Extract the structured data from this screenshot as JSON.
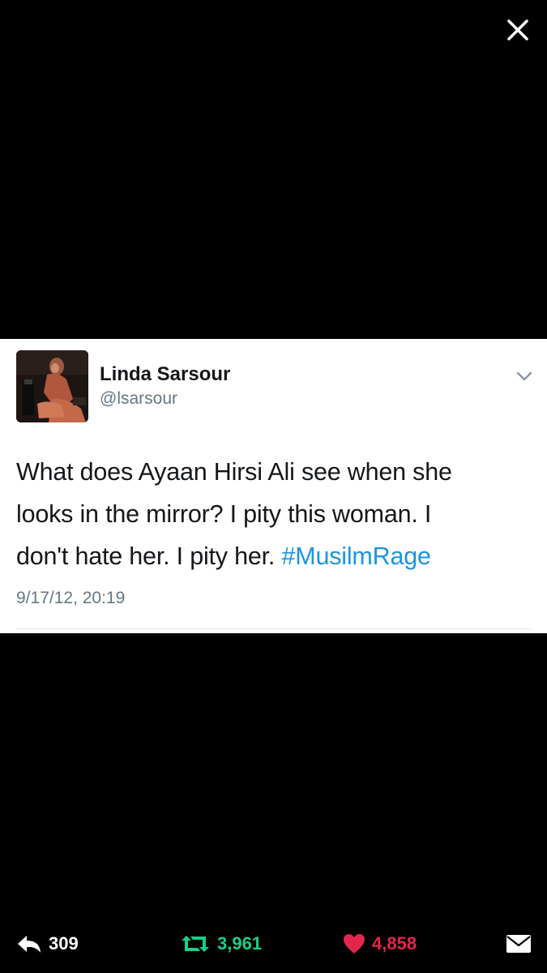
{
  "viewer": {
    "close_icon": "close-icon"
  },
  "tweet": {
    "author_name": "Linda Sarsour",
    "author_handle": "@lsarsour",
    "text_lines": [
      "What does Ayaan Hirsi Ali see when she",
      "looks in the mirror? I pity this woman. I",
      "don't hate her. I pity her. "
    ],
    "hashtag": "#MusilmRage",
    "timestamp": "9/17/12, 20:19"
  },
  "actions": {
    "reply_count": "309",
    "retweet_count": "3,961",
    "like_count": "4,858"
  },
  "colors": {
    "background": "#000000",
    "card": "#ffffff",
    "hashtag": "#1b95e0",
    "retweet": "#19cf86",
    "like": "#e2264d",
    "secondary_text": "#657786"
  }
}
